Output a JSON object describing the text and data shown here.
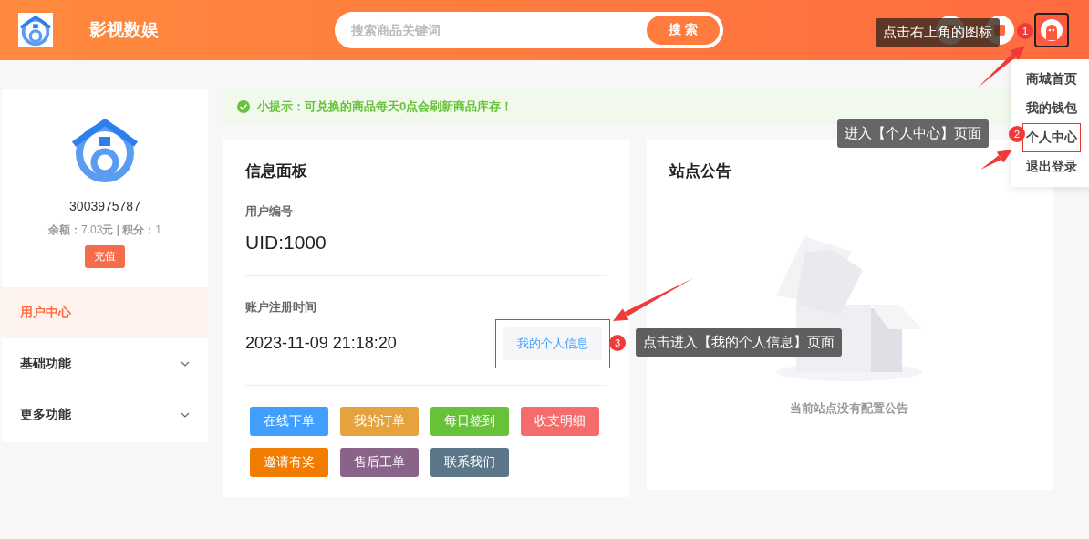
{
  "header": {
    "site_name": "影视数娱",
    "search": {
      "placeholder": "搜索商品关键词",
      "button": "搜 索"
    }
  },
  "user_menu": {
    "items": [
      {
        "label": "商城首页",
        "highlighted": false
      },
      {
        "label": "我的钱包",
        "highlighted": false
      },
      {
        "label": "个人中心",
        "highlighted": true
      },
      {
        "label": "退出登录",
        "highlighted": false
      }
    ]
  },
  "sidebar": {
    "user_id": "3003975787",
    "balance": "**余额：**7.03**元 | 积分：**1",
    "recharge": "充值",
    "nav": [
      {
        "label": "用户中心",
        "selected": true
      },
      {
        "label": "基础功能",
        "selected": false,
        "expanded": false
      },
      {
        "label": "更多功能",
        "selected": false,
        "expanded": false
      }
    ]
  },
  "tip": "小提示：可兑换的商品每天0点会刷新商品库存！",
  "info_panel": {
    "title": "信息面板",
    "user_no_label": "用户编号",
    "user_no": "UID:1000",
    "reg_label": "账户注册时间",
    "reg_time": "2023-11-09 21:18:20",
    "profile_button": {
      "label": "我的个人信息",
      "highlighted": true
    },
    "actions": [
      {
        "label": "在线下单",
        "color": "#409eff"
      },
      {
        "label": "我的订单",
        "color": "#e6a23c"
      },
      {
        "label": "每日签到",
        "color": "#67c23a"
      },
      {
        "label": "收支明细",
        "color": "#f56c6c"
      },
      {
        "label": "邀请有奖",
        "color": "#f07c00"
      },
      {
        "label": "售后工单",
        "color": "#8a6389"
      },
      {
        "label": "联系我们",
        "color": "#5b7689"
      }
    ]
  },
  "notice": {
    "title": "站点公告",
    "empty_text": "当前站点没有配置公告"
  },
  "annotations": [
    {
      "number": "1",
      "text": "点击右上角的图标"
    },
    {
      "number": "2",
      "text": "进入【个人中心】页面"
    },
    {
      "number": "3",
      "text": "点击进入【我的个人信息】页面"
    }
  ]
}
